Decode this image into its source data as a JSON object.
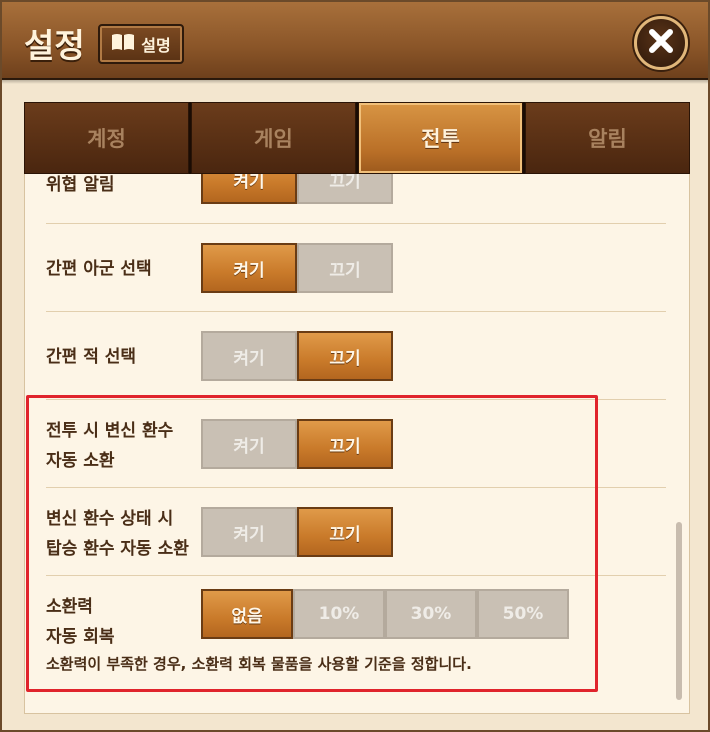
{
  "header": {
    "title": "설정",
    "help_label": "설명"
  },
  "tabs": [
    {
      "label": "계정",
      "active": false
    },
    {
      "label": "게임",
      "active": false
    },
    {
      "label": "전투",
      "active": true
    },
    {
      "label": "알림",
      "active": false
    }
  ],
  "rows": [
    {
      "label": "위협 알림",
      "options": [
        "켜기",
        "끄기"
      ],
      "selected": "켜기"
    },
    {
      "label": "간편 아군 선택",
      "options": [
        "켜기",
        "끄기"
      ],
      "selected": "켜기"
    },
    {
      "label": "간편 적 선택",
      "options": [
        "켜기",
        "끄기"
      ],
      "selected": "끄기"
    },
    {
      "label_line1": "전투 시 변신 환수",
      "label_line2": "자동 소환",
      "options": [
        "켜기",
        "끄기"
      ],
      "selected": "끄기"
    },
    {
      "label_line1": "변신 환수 상태 시",
      "label_line2": "탑승 환수 자동 소환",
      "options": [
        "켜기",
        "끄기"
      ],
      "selected": "끄기"
    },
    {
      "label_line1": "소환력",
      "label_line2": "자동 회복",
      "options": [
        "없음",
        "10%",
        "30%",
        "50%"
      ],
      "selected": "없음"
    }
  ],
  "hint": "소환력이 부족한 경우, 소환력 회복 물품을 사용할 기준을 정합니다.",
  "colors": {
    "accent": "#c97a2a",
    "highlight": "#e0242c",
    "header": "#8a5528"
  },
  "icons": {
    "help": "book-icon",
    "close": "close-icon"
  }
}
